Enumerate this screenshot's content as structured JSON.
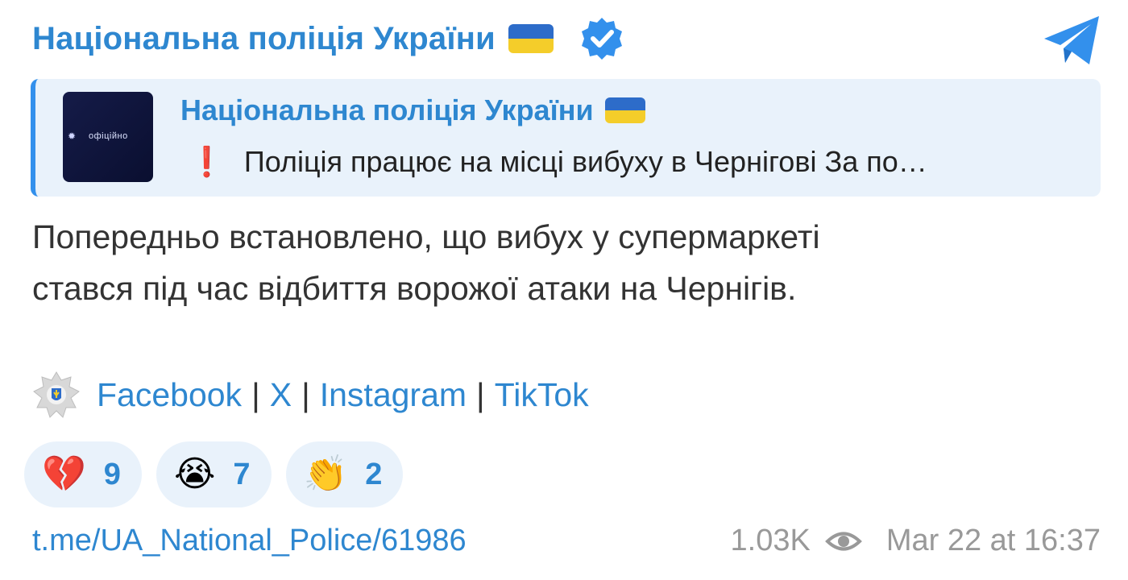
{
  "header": {
    "channel_name": "Національна поліція України",
    "flag_colors": [
      "#2d6cc9",
      "#f4cd2a"
    ],
    "verified_icon": "verified-badge-icon",
    "app_icon": "telegram-icon",
    "accent": "#2e87d0"
  },
  "quote": {
    "title": "Національна поліція України",
    "thumbnail_text": "офіційно",
    "excl_icon": "❗",
    "body": "Поліція працює на місці вибуху в Чернігові За по…"
  },
  "message": {
    "line1": "Попередньо встановлено, що вибух у супермаркеті",
    "line2": "стався під час відбиття ворожої атаки на Чернігів."
  },
  "links": {
    "emblem_icon": "police-emblem-icon",
    "items": [
      "Facebook",
      "X",
      "Instagram",
      "TikTok"
    ],
    "separator": "|"
  },
  "reactions": [
    {
      "emoji": "💔",
      "name": "broken-heart",
      "count": "9"
    },
    {
      "emoji": "😭",
      "name": "crying-face",
      "count": "7"
    },
    {
      "emoji": "👏",
      "name": "clapping-hands",
      "count": "2"
    }
  ],
  "footer": {
    "link": "t.me/UA_National_Police/61986",
    "views": "1.03K",
    "views_icon": "eye-icon",
    "timestamp": "Mar 22 at 16:37"
  }
}
